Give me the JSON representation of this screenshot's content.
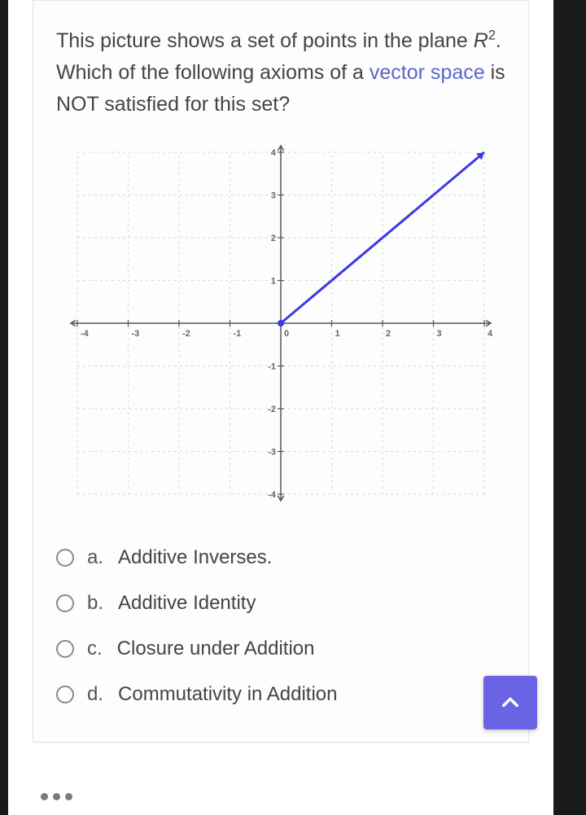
{
  "question": {
    "part1": "This picture shows a set of points in the plane ",
    "math_base": "R",
    "math_sup": "2",
    "part2": ". Which of the following axioms of a ",
    "link_text": "vector space",
    "part3": " is NOT satisfied for this set?"
  },
  "options": [
    {
      "letter": "a.",
      "text": "Additive Inverses."
    },
    {
      "letter": "b.",
      "text": "Additive Identity"
    },
    {
      "letter": "c.",
      "text": "Closure under Addition"
    },
    {
      "letter": "d.",
      "text": "Commutativity in Addition"
    }
  ],
  "chart_data": {
    "type": "line",
    "title": "",
    "xlabel": "",
    "ylabel": "",
    "xlim": [
      -4,
      4
    ],
    "ylim": [
      -4,
      4
    ],
    "x_ticks": [
      -4,
      -3,
      -2,
      -1,
      0,
      1,
      2,
      3,
      4
    ],
    "y_ticks": [
      -4,
      -3,
      -2,
      -1,
      0,
      1,
      2,
      3,
      4
    ],
    "series": [
      {
        "name": "ray",
        "color": "#3a3ae6",
        "x": [
          0,
          4
        ],
        "y": [
          0,
          4
        ]
      }
    ],
    "grid": true,
    "x_arrows": true,
    "y_arrows": true
  },
  "icons": {
    "scroll_top": "chevron-up",
    "pen": "edit-pen"
  }
}
